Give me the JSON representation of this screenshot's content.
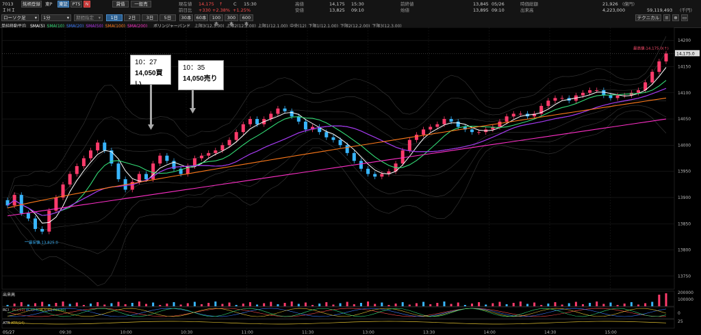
{
  "header": {
    "code": "7013",
    "name": "ＩＨＩ",
    "register_button": "銘柄登録",
    "market_label": "東P",
    "market_button_active": "東証",
    "pts_button": "PTS",
    "n_icon_label": "N",
    "credit_button": "貸借",
    "general_button": "一般売",
    "chart_type_select": "ローソク足",
    "interval_select": "1分",
    "range_select": "期間指定",
    "day_tabs": [
      "1日",
      "2日",
      "3日",
      "5日"
    ],
    "bar_tabs": [
      "30本",
      "60本",
      "100本",
      "300本",
      "600本"
    ],
    "technical_button": "テクニカル",
    "quote": {
      "current_label": "現在値",
      "current_value": "14,175",
      "current_mark": "↑",
      "current_flag": "C",
      "current_time": "15:30",
      "change_label": "前日比",
      "change_value": "+330",
      "change_pct": "+2.38%",
      "change_pct2": "+1.25%",
      "high_label": "高値",
      "high_value": "14,175",
      "high_time": "15:30",
      "low_label": "安値",
      "low_value": "13,825",
      "low_time": "09:10",
      "prev_label": "前終値",
      "prev_value": "13,845",
      "prev_date": "05/26",
      "open_label": "始値",
      "open_value": "13,895",
      "open_time": "09:10",
      "mktcap_label": "時価総額",
      "mktcap_value": "21,926",
      "mktcap_unit": "(億円)",
      "volume_label": "出来高",
      "volume_value": "4,223,000",
      "turnover_value": "59,119,493",
      "turnover_unit": "(千円)"
    }
  },
  "legend": {
    "title": "単純移動平均",
    "sma": [
      {
        "label": "SMA(5)",
        "color": "#ffffff"
      },
      {
        "label": "SMA(10)",
        "color": "#33dd77"
      },
      {
        "label": "SMA(20)",
        "color": "#3a7bff"
      },
      {
        "label": "SMA(50)",
        "color": "#b030e8"
      },
      {
        "label": "SMA(100)",
        "color": "#ff7a1a"
      },
      {
        "label": "SMA(200)",
        "color": "#ff2fc8"
      }
    ],
    "bb_title": "ボリンジャーバンド",
    "bb_items": [
      "上限3(12,3.00)",
      "上限2(12,2.00)",
      "上限1(12,1.00)",
      "中央(12)",
      "下限1(12,1.00)",
      "下限2(12,2.00)",
      "下限3(12,3.00)"
    ]
  },
  "annotations": [
    {
      "time": "10：27",
      "text": "14,050買い"
    },
    {
      "time": "10：35",
      "text": "14,050売り"
    }
  ],
  "price_axis": {
    "ticks": [
      "14200",
      "14150",
      "14100",
      "14050",
      "14000",
      "13950",
      "13900",
      "13850",
      "13800",
      "13750"
    ],
    "current_tag": "14,175.0",
    "high_marker": "最高値:14,175.0(↑)",
    "low_marker": "最安値:13,825.0"
  },
  "volume_panel": {
    "title": "出来高",
    "axis_ticks": [
      "200000",
      "100000"
    ]
  },
  "rci_panel": {
    "title": "RCI",
    "items": [
      "RCI(10)",
      "RCI(20)",
      "RCI(30)",
      "RCI(40)"
    ],
    "axis_ticks": [
      "0"
    ]
  },
  "atr_panel": {
    "title": "ATR",
    "item": "ATR(14)",
    "axis_ticks": [
      "25"
    ]
  },
  "time_axis": {
    "date": "05/27",
    "ticks": [
      "09:30",
      "10:00",
      "10:30",
      "11:00",
      "11:30",
      "13:00",
      "13:30",
      "14:00",
      "14:30",
      "15:00"
    ]
  },
  "chart_data": {
    "type": "candlestick",
    "ylim": [
      13725,
      14225
    ],
    "close_series": [
      13885,
      13905,
      13870,
      13860,
      13840,
      13835,
      13875,
      13900,
      13925,
      13945,
      13960,
      13975,
      13990,
      14005,
      13990,
      13965,
      13935,
      13915,
      13930,
      13945,
      13935,
      13965,
      13980,
      13970,
      13955,
      13945,
      13960,
      13975,
      13980,
      13985,
      13990,
      14000,
      14010,
      14025,
      14040,
      14050,
      14040,
      14050,
      14060,
      14070,
      14065,
      14055,
      14045,
      14030,
      14035,
      14025,
      14015,
      14010,
      14000,
      13985,
      13970,
      13955,
      13945,
      13940,
      13945,
      13950,
      13965,
      13990,
      14010,
      14020,
      14030,
      14035,
      14040,
      14050,
      14045,
      14035,
      14030,
      14025,
      14025,
      14030,
      14035,
      14045,
      14055,
      14060,
      14060,
      14055,
      14060,
      14075,
      14085,
      14090,
      14090,
      14085,
      14095,
      14100,
      14105,
      14105,
      14095,
      14090,
      14095,
      14095,
      14100,
      14105,
      14120,
      14140,
      14160,
      14175
    ],
    "sma_series_labels": [
      "SMA(5)",
      "SMA(10)",
      "SMA(20)",
      "SMA(50)",
      "SMA(100)",
      "SMA(200)"
    ],
    "high": 14175,
    "low": 13825
  }
}
